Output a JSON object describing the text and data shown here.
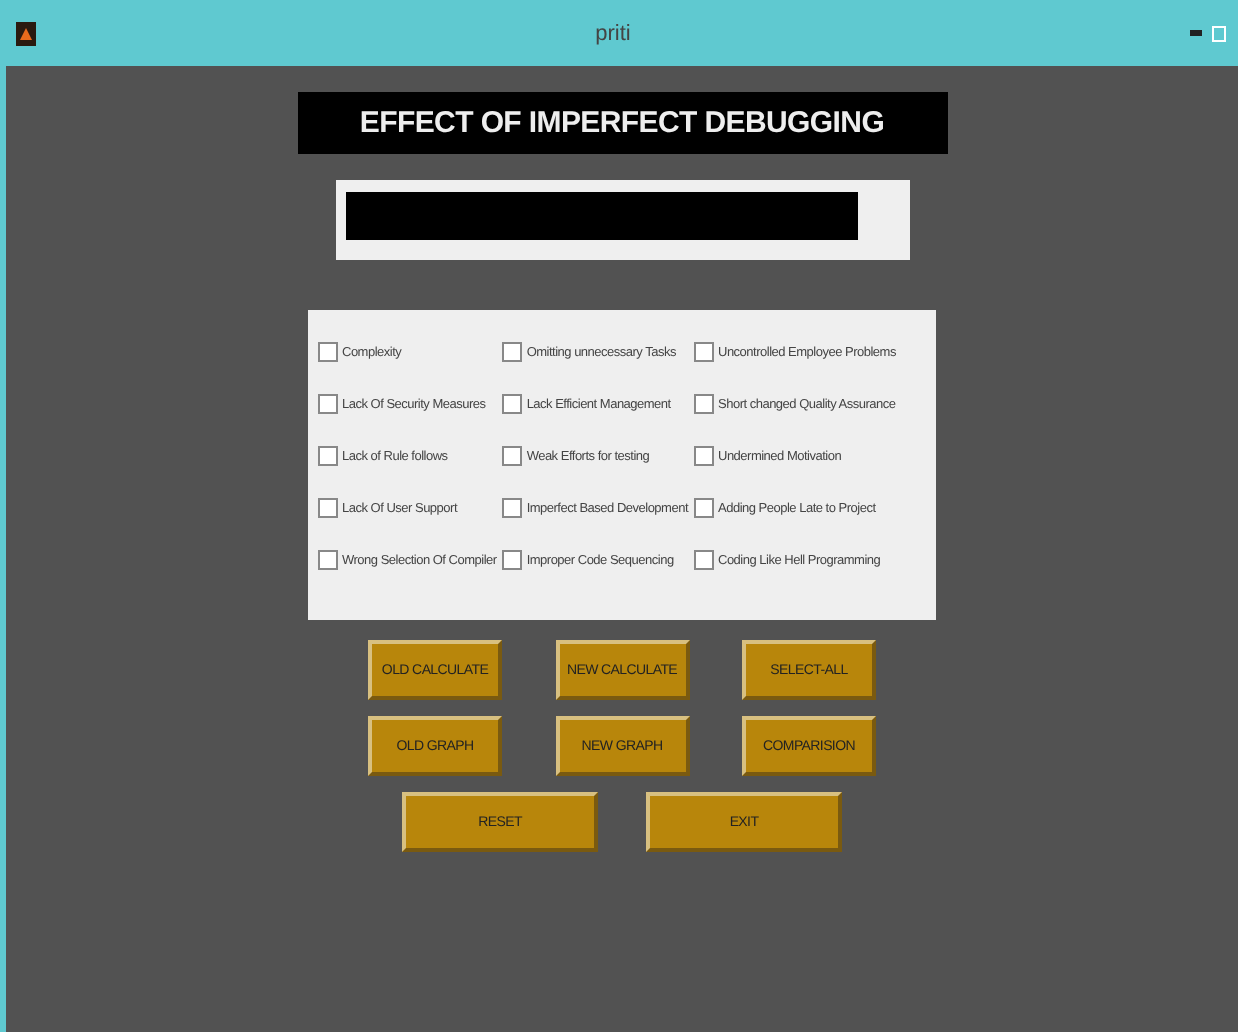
{
  "window": {
    "title": "priti"
  },
  "heading": "EFFECT OF IMPERFECT DEBUGGING",
  "checkboxes": [
    {
      "label": "Complexity",
      "checked": false
    },
    {
      "label": "Omitting unnecessary Tasks",
      "checked": false
    },
    {
      "label": "Uncontrolled Employee Problems",
      "checked": false
    },
    {
      "label": "Lack Of Security Measures",
      "checked": false
    },
    {
      "label": "Lack Efficient Management",
      "checked": false
    },
    {
      "label": "Short changed Quality Assurance",
      "checked": false
    },
    {
      "label": "Lack of Rule follows",
      "checked": false
    },
    {
      "label": "Weak Efforts for testing",
      "checked": false
    },
    {
      "label": "Undermined Motivation",
      "checked": false
    },
    {
      "label": "Lack Of User Support",
      "checked": false
    },
    {
      "label": "Imperfect Based Development",
      "checked": false
    },
    {
      "label": "Adding People Late to Project",
      "checked": false
    },
    {
      "label": "Wrong Selection Of Compiler",
      "checked": false
    },
    {
      "label": "Improper Code Sequencing",
      "checked": false
    },
    {
      "label": "Coding Like Hell Programming",
      "checked": false
    }
  ],
  "button_rows": [
    [
      "OLD CALCULATE",
      "NEW CALCULATE",
      "SELECT-ALL"
    ],
    [
      "OLD GRAPH",
      "NEW GRAPH",
      "COMPARISION"
    ],
    [
      "RESET",
      "EXIT"
    ]
  ]
}
